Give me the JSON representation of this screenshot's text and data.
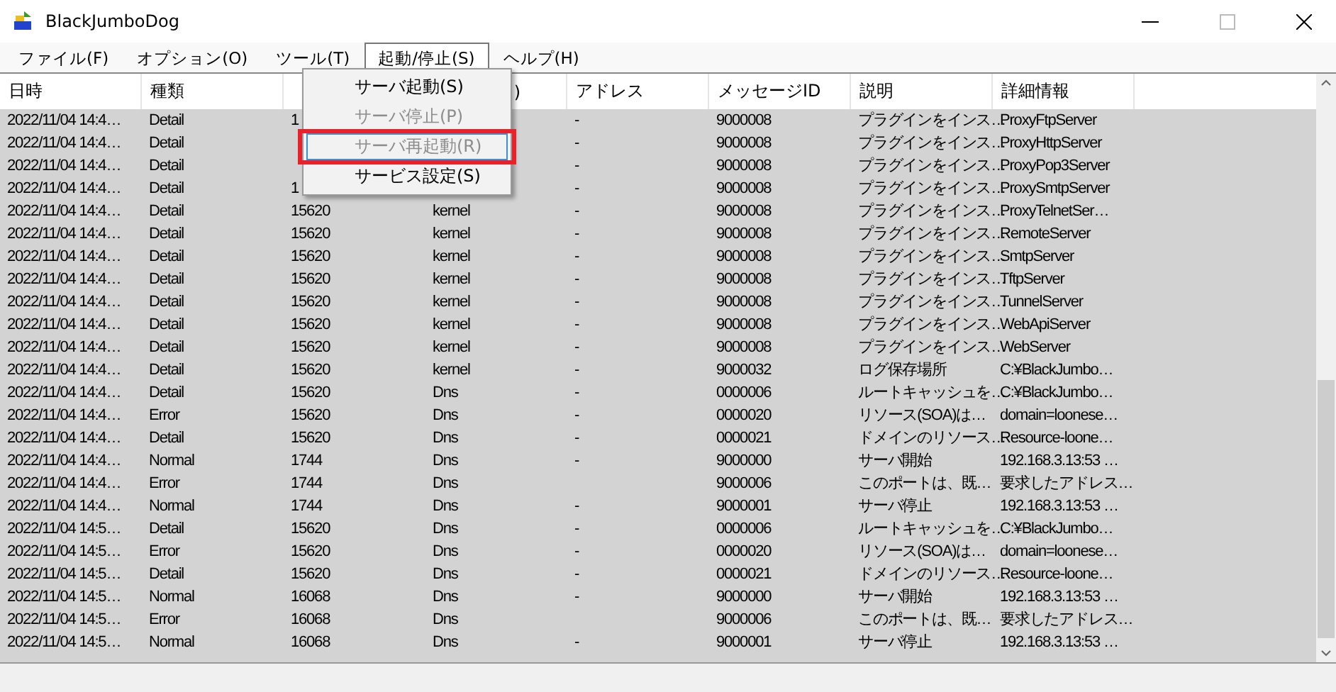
{
  "window": {
    "title": "BlackJumboDog"
  },
  "menu_bar": [
    {
      "label": "ファイル(F)",
      "selected": false
    },
    {
      "label": "オプション(O)",
      "selected": false
    },
    {
      "label": "ツール(T)",
      "selected": false
    },
    {
      "label": "起動/停止(S)",
      "selected": true
    },
    {
      "label": "ヘルプ(H)",
      "selected": false
    }
  ],
  "dropdown": [
    {
      "label": "サーバ起動(S)",
      "disabled": false,
      "highlighted": false
    },
    {
      "label": "サーバ停止(P)",
      "disabled": true,
      "highlighted": false
    },
    {
      "label": "サーバ再起動(R)",
      "disabled": true,
      "highlighted": true
    },
    {
      "label": "サービス設定(S)",
      "disabled": false,
      "highlighted": false
    }
  ],
  "table": {
    "columns": [
      {
        "label": "日時"
      },
      {
        "label": "種類"
      },
      {},
      {
        "label": ")"
      },
      {
        "label": "アドレス"
      },
      {
        "label": "メッセージID"
      },
      {
        "label": "説明"
      },
      {
        "label": "詳細情報"
      }
    ],
    "rows": [
      [
        "2022/11/04 14:4…",
        "Detail",
        "1",
        "",
        "-",
        "9000008",
        "プラグインをインス…",
        "ProxyFtpServer"
      ],
      [
        "2022/11/04 14:4…",
        "Detail",
        "",
        "",
        "-",
        "9000008",
        "プラグインをインス…",
        "ProxyHttpServer"
      ],
      [
        "2022/11/04 14:4…",
        "Detail",
        "",
        "",
        "-",
        "9000008",
        "プラグインをインス…",
        "ProxyPop3Server"
      ],
      [
        "2022/11/04 14:4…",
        "Detail",
        "1",
        "",
        "-",
        "9000008",
        "プラグインをインス…",
        "ProxySmtpServer"
      ],
      [
        "2022/11/04 14:4…",
        "Detail",
        "15620",
        "kernel",
        "-",
        "9000008",
        "プラグインをインス…",
        "ProxyTelnetSer…"
      ],
      [
        "2022/11/04 14:4…",
        "Detail",
        "15620",
        "kernel",
        "-",
        "9000008",
        "プラグインをインス…",
        "RemoteServer"
      ],
      [
        "2022/11/04 14:4…",
        "Detail",
        "15620",
        "kernel",
        "-",
        "9000008",
        "プラグインをインス…",
        "SmtpServer"
      ],
      [
        "2022/11/04 14:4…",
        "Detail",
        "15620",
        "kernel",
        "-",
        "9000008",
        "プラグインをインス…",
        "TftpServer"
      ],
      [
        "2022/11/04 14:4…",
        "Detail",
        "15620",
        "kernel",
        "-",
        "9000008",
        "プラグインをインス…",
        "TunnelServer"
      ],
      [
        "2022/11/04 14:4…",
        "Detail",
        "15620",
        "kernel",
        "-",
        "9000008",
        "プラグインをインス…",
        "WebApiServer"
      ],
      [
        "2022/11/04 14:4…",
        "Detail",
        "15620",
        "kernel",
        "-",
        "9000008",
        "プラグインをインス…",
        "WebServer"
      ],
      [
        "2022/11/04 14:4…",
        "Detail",
        "15620",
        "kernel",
        "-",
        "9000032",
        "ログ保存場所",
        "C:¥BlackJumbo…"
      ],
      [
        "2022/11/04 14:4…",
        "Detail",
        "15620",
        "Dns",
        "-",
        "0000006",
        "ルートキャッシュを…",
        "C:¥BlackJumbo…"
      ],
      [
        "2022/11/04 14:4…",
        "Error",
        "15620",
        "Dns",
        "-",
        "0000020",
        "リソース(SOA)は…",
        "domain=loonese…"
      ],
      [
        "2022/11/04 14:4…",
        "Detail",
        "15620",
        "Dns",
        "-",
        "0000021",
        "ドメインのリソース…",
        "Resource-loone…"
      ],
      [
        "2022/11/04 14:4…",
        "Normal",
        "1744",
        "Dns",
        "-",
        "9000000",
        "サーバ開始",
        "192.168.3.13:53 …"
      ],
      [
        "2022/11/04 14:4…",
        "Error",
        "1744",
        "Dns",
        "",
        "9000006",
        "このポートは、既…",
        "要求したアドレス…"
      ],
      [
        "2022/11/04 14:4…",
        "Normal",
        "1744",
        "Dns",
        "-",
        "9000001",
        "サーバ停止",
        "192.168.3.13:53 …"
      ],
      [
        "2022/11/04 14:5…",
        "Detail",
        "15620",
        "Dns",
        "-",
        "0000006",
        "ルートキャッシュを…",
        "C:¥BlackJumbo…"
      ],
      [
        "2022/11/04 14:5…",
        "Error",
        "15620",
        "Dns",
        "-",
        "0000020",
        "リソース(SOA)は…",
        "domain=loonese…"
      ],
      [
        "2022/11/04 14:5…",
        "Detail",
        "15620",
        "Dns",
        "-",
        "0000021",
        "ドメインのリソース…",
        "Resource-loone…"
      ],
      [
        "2022/11/04 14:5…",
        "Normal",
        "16068",
        "Dns",
        "-",
        "9000000",
        "サーバ開始",
        "192.168.3.13:53 …"
      ],
      [
        "2022/11/04 14:5…",
        "Error",
        "16068",
        "Dns",
        "",
        "9000006",
        "このポートは、既…",
        "要求したアドレス…"
      ],
      [
        "2022/11/04 14:5…",
        "Normal",
        "16068",
        "Dns",
        "-",
        "9000001",
        "サーバ停止",
        "192.168.3.13:53 …"
      ]
    ]
  }
}
